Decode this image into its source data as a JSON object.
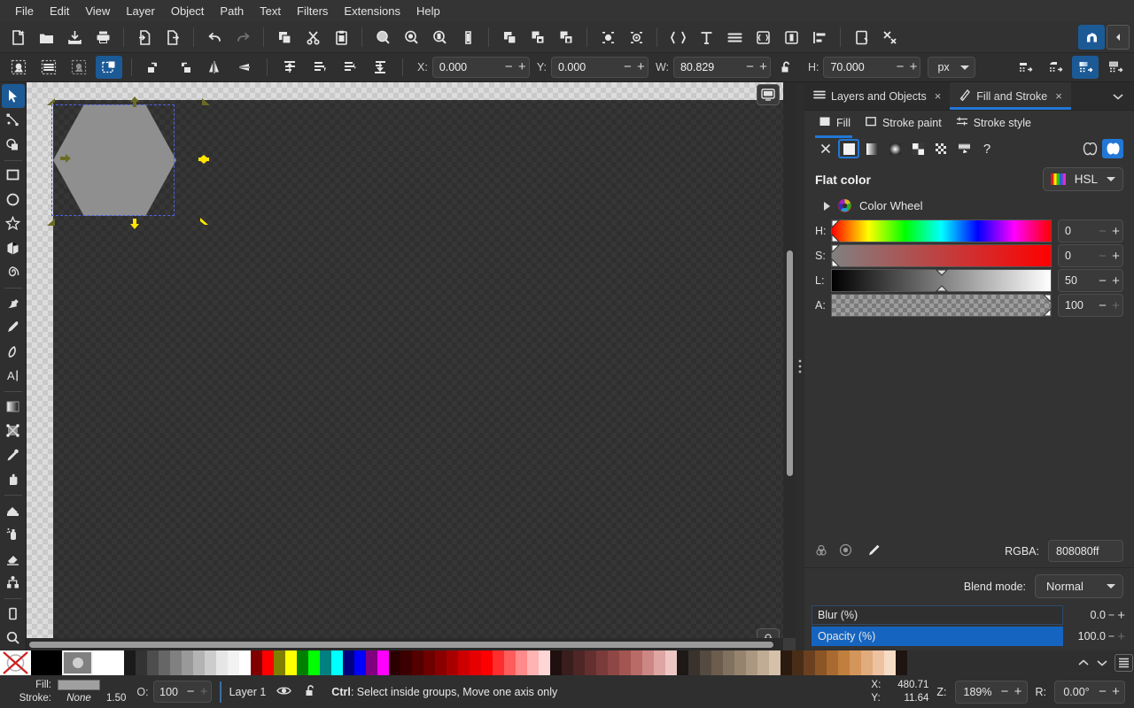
{
  "app": {
    "title": "Inkscape",
    "theme_bg": "#2d2d2d",
    "accent": "#2277d6"
  },
  "menubar": {
    "items": [
      {
        "label": "File"
      },
      {
        "label": "Edit"
      },
      {
        "label": "View"
      },
      {
        "label": "Layer"
      },
      {
        "label": "Object"
      },
      {
        "label": "Path"
      },
      {
        "label": "Text"
      },
      {
        "label": "Filters"
      },
      {
        "label": "Extensions"
      },
      {
        "label": "Help"
      }
    ]
  },
  "commandbar": {
    "buttons": [
      {
        "name": "new-document",
        "icon": "new-document-icon"
      },
      {
        "name": "open-document",
        "icon": "open-folder-icon"
      },
      {
        "name": "save-document",
        "icon": "save-icon"
      },
      {
        "name": "print-document",
        "icon": "print-icon"
      },
      {
        "name": "import",
        "icon": "import-icon"
      },
      {
        "name": "export",
        "icon": "export-icon"
      },
      {
        "name": "undo",
        "icon": "undo-arrow-icon"
      },
      {
        "name": "redo",
        "icon": "redo-arrow-icon"
      },
      {
        "name": "copy",
        "icon": "copy-icon"
      },
      {
        "name": "cut",
        "icon": "scissors-icon"
      },
      {
        "name": "paste",
        "icon": "clipboard-icon"
      },
      {
        "name": "zoom-selection",
        "icon": "zoom-selection-icon"
      },
      {
        "name": "zoom-drawing",
        "icon": "zoom-drawing-icon"
      },
      {
        "name": "zoom-page",
        "icon": "zoom-page-icon"
      },
      {
        "name": "zoom-page-width",
        "icon": "zoom-width-icon"
      },
      {
        "name": "zoom-center-page",
        "icon": "zoom-center-icon"
      },
      {
        "name": "duplicate",
        "icon": "duplicate-icon"
      },
      {
        "name": "group",
        "icon": "group-icon"
      },
      {
        "name": "ungroup",
        "icon": "ungroup-icon"
      },
      {
        "name": "clip-set",
        "icon": "clip-icon"
      },
      {
        "name": "mask-set",
        "icon": "mask-icon"
      },
      {
        "name": "xml-editor",
        "icon": "xml-editor-icon"
      },
      {
        "name": "text-tool-dialog",
        "icon": "text-icon"
      },
      {
        "name": "layers-dialog",
        "icon": "layers-icon"
      },
      {
        "name": "document-properties",
        "icon": "document-properties-icon"
      },
      {
        "name": "document-resources",
        "icon": "document-resources-icon"
      },
      {
        "name": "align-distribute",
        "icon": "align-icon"
      },
      {
        "name": "preferences",
        "icon": "preferences-icon"
      },
      {
        "name": "input-devices",
        "icon": "tools-icon"
      }
    ],
    "snap_toggle": {
      "name": "snap-controls-toggle",
      "icon": "snap-magnet-icon",
      "active": true
    },
    "collapse": {
      "name": "collapse-toolbar-button",
      "icon": "chevron-left-icon"
    }
  },
  "toolcontrols": {
    "buttons": [
      {
        "name": "select-all",
        "icon": "select-all-icon",
        "active": false
      },
      {
        "name": "select-all-in-all-layers",
        "icon": "select-all-layers-icon",
        "active": false
      },
      {
        "name": "deselect",
        "icon": "deselect-icon",
        "active": false
      },
      {
        "name": "select-touch",
        "icon": "rubber-band-touch-icon",
        "active": true
      },
      {
        "name": "rotate-ccw",
        "icon": "rotate-ccw-icon",
        "active": false
      },
      {
        "name": "rotate-cw",
        "icon": "rotate-cw-icon",
        "active": false
      },
      {
        "name": "flip-horizontal",
        "icon": "flip-horizontal-icon",
        "active": false
      },
      {
        "name": "flip-vertical",
        "icon": "flip-vertical-icon",
        "active": false
      },
      {
        "name": "raise-to-top",
        "icon": "raise-to-top-icon",
        "active": false
      },
      {
        "name": "raise",
        "icon": "raise-icon",
        "active": false
      },
      {
        "name": "lower",
        "icon": "lower-icon",
        "active": false
      },
      {
        "name": "lower-to-bottom",
        "icon": "lower-to-bottom-icon",
        "active": false
      }
    ],
    "x": {
      "label": "X:",
      "value": "0.000"
    },
    "y": {
      "label": "Y:",
      "value": "0.000"
    },
    "w": {
      "label": "W:",
      "value": "80.829"
    },
    "h": {
      "label": "H:",
      "value": "70.000"
    },
    "lock": {
      "name": "lock-wh-ratio",
      "icon": "lock-open-icon"
    },
    "units": {
      "value": "px"
    },
    "snap_buttons": [
      {
        "name": "affect-stroke-width",
        "icon": "scale-stroke-icon",
        "active": false
      },
      {
        "name": "affect-rounded-corners",
        "icon": "scale-corners-icon",
        "active": false
      },
      {
        "name": "affect-gradients",
        "icon": "transform-gradient-icon",
        "active": true
      },
      {
        "name": "affect-patterns",
        "icon": "transform-pattern-icon",
        "active": false
      }
    ]
  },
  "toolbox": {
    "tools": [
      {
        "name": "selector-tool",
        "icon": "arrow-cursor-icon",
        "active": true
      },
      {
        "name": "node-tool",
        "icon": "node-editor-icon",
        "active": false
      },
      {
        "name": "shape-builder-tool",
        "icon": "shape-builder-icon",
        "active": false
      },
      {
        "name": "rectangle-tool",
        "icon": "rectangle-icon",
        "active": false
      },
      {
        "name": "ellipse-tool",
        "icon": "ellipse-icon",
        "active": false
      },
      {
        "name": "star-tool",
        "icon": "star-icon",
        "active": false
      },
      {
        "name": "box3d-tool",
        "icon": "cube-3d-icon",
        "active": false
      },
      {
        "name": "spiral-tool",
        "icon": "spiral-icon",
        "active": false
      },
      {
        "name": "pencil-tool",
        "icon": "pencil-freehand-icon",
        "active": false
      },
      {
        "name": "pen-tool",
        "icon": "bezier-pen-icon",
        "active": false
      },
      {
        "name": "calligraphy-tool",
        "icon": "calligraphy-icon",
        "active": false
      },
      {
        "name": "text-tool",
        "icon": "text-a-icon",
        "active": false
      },
      {
        "name": "gradient-tool",
        "icon": "gradient-icon",
        "active": false
      },
      {
        "name": "mesh-gradient-tool",
        "icon": "mesh-gradient-icon",
        "active": false
      },
      {
        "name": "dropper-tool",
        "icon": "eyedropper-icon",
        "active": false
      },
      {
        "name": "tweak-tool",
        "icon": "tweak-hand-icon",
        "active": false
      },
      {
        "name": "paint-bucket-tool",
        "icon": "paint-bucket-icon",
        "active": false
      },
      {
        "name": "spray-tool",
        "icon": "spray-can-icon",
        "active": false
      },
      {
        "name": "eraser-tool",
        "icon": "eraser-icon",
        "active": false
      },
      {
        "name": "connector-tool",
        "icon": "connector-icon",
        "active": false
      },
      {
        "name": "pages-tool",
        "icon": "page-icon",
        "active": false
      },
      {
        "name": "zoom-tool",
        "icon": "magnifier-icon",
        "active": false
      }
    ]
  },
  "canvas": {
    "object": {
      "name": "hexagon-shape",
      "fill": "#8f8f8f",
      "description": "hexagon"
    },
    "selection": {
      "dashed_color": "#4f62e0",
      "handle_color": "#ffe400",
      "handle_color_dim": "#6b6b25"
    },
    "display_mode_button": {
      "name": "display-mode-button",
      "icon": "monitor-icon"
    },
    "cms_button": {
      "name": "color-management-button",
      "icon": "cms-icon"
    },
    "dock_grip": {
      "name": "dock-resize-grip",
      "icon": "grip-dots-icon"
    }
  },
  "dock": {
    "tabs": [
      {
        "name": "layers-and-objects",
        "label": "Layers and Objects",
        "icon": "layers-stack-icon",
        "active": false,
        "close": "×"
      },
      {
        "name": "fill-and-stroke",
        "label": "Fill and Stroke",
        "icon": "fill-stroke-icon",
        "active": true,
        "close": "×"
      }
    ],
    "tab_menu": {
      "name": "dock-menu-button",
      "icon": "chevron-down-icon"
    },
    "fillstroke": {
      "subtabs": [
        {
          "name": "tab-fill",
          "label": "Fill",
          "icon": "fill-square-icon",
          "active": true
        },
        {
          "name": "tab-stroke-paint",
          "label": "Stroke paint",
          "icon": "stroke-square-icon",
          "active": false
        },
        {
          "name": "tab-stroke-style",
          "label": "Stroke style",
          "icon": "stroke-style-icon",
          "active": false
        }
      ],
      "paint_types": [
        {
          "name": "paint-none",
          "icon": "x-none-icon",
          "selected": false
        },
        {
          "name": "paint-flat-color",
          "icon": "flat-color-icon",
          "selected": true
        },
        {
          "name": "paint-linear-gradient",
          "icon": "linear-gradient-icon",
          "selected": false
        },
        {
          "name": "paint-radial-gradient",
          "icon": "radial-gradient-icon",
          "selected": false
        },
        {
          "name": "paint-pattern",
          "icon": "pattern-icon",
          "selected": false
        },
        {
          "name": "paint-swatch",
          "icon": "swatch-icon",
          "selected": false
        },
        {
          "name": "paint-mesh-gradient",
          "icon": "mesh-icon",
          "selected": false
        },
        {
          "name": "paint-unknown",
          "icon": "question-mark-icon",
          "selected": false
        }
      ],
      "fillrule_buttons": [
        {
          "name": "fill-rule-evenodd",
          "icon": "fill-rule-evenodd-icon",
          "selected": false
        },
        {
          "name": "fill-rule-nonzero",
          "icon": "fill-rule-nonzero-icon",
          "selected": true
        }
      ],
      "flat_color_label": "Flat color",
      "color_mode": {
        "label": "HSL",
        "name": "color-mode-selector"
      },
      "color_wheel": {
        "label": "Color Wheel",
        "expanded": false
      },
      "sliders": [
        {
          "name": "hue-slider",
          "label": "H:",
          "value": "0",
          "minus_disabled": true,
          "plus_disabled": false
        },
        {
          "name": "saturation-slider",
          "label": "S:",
          "value": "0",
          "minus_disabled": true,
          "plus_disabled": false
        },
        {
          "name": "lightness-slider",
          "label": "L:",
          "value": "50",
          "minus_disabled": false,
          "plus_disabled": false
        },
        {
          "name": "alpha-slider",
          "label": "A:",
          "value": "100",
          "minus_disabled": false,
          "plus_disabled": true
        }
      ],
      "rgba": {
        "label": "RGBA:",
        "value": "808080ff"
      },
      "bottom_icons": [
        {
          "name": "color-managed-icon",
          "icon": "cms-circle-icon"
        },
        {
          "name": "out-of-gamut-icon",
          "icon": "gamut-warning-icon"
        },
        {
          "name": "pick-color-button",
          "icon": "eyedropper-icon"
        }
      ],
      "blend_mode": {
        "label": "Blend mode:",
        "value": "Normal"
      },
      "blur": {
        "label": "Blur (%)",
        "value": "0.0"
      },
      "opacity": {
        "label": "Opacity (%)",
        "value": "100.0"
      }
    }
  },
  "palette": {
    "colors": [
      "none",
      "#000000",
      "#808080",
      "#ffffff",
      "#1a1a1a",
      "#333333",
      "#4d4d4d",
      "#666666",
      "#808080",
      "#999999",
      "#b3b3b3",
      "#cccccc",
      "#e6e6e6",
      "#f2f2f2",
      "#ffffff",
      "#800000",
      "#ff0000",
      "#808000",
      "#ffff00",
      "#008000",
      "#00ff00",
      "#008080",
      "#00ffff",
      "#000080",
      "#0000ff",
      "#800080",
      "#ff00ff",
      "#2b0000",
      "#3d0000",
      "#550000",
      "#6e0000",
      "#8a0000",
      "#a80000",
      "#cc0000",
      "#e60000",
      "#ff0000",
      "#ff2e2e",
      "#ff5c5c",
      "#ff8a8a",
      "#ffb3b3",
      "#ffd6d6",
      "#1f0f0f",
      "#3a1d1d",
      "#4f2626",
      "#63302f",
      "#7a3b3a",
      "#8e4745",
      "#a35552",
      "#b96b68",
      "#cc8683",
      "#dda6a3",
      "#eec7c5",
      "#1c1917",
      "#3a332d",
      "#554a40",
      "#6b5c4e",
      "#80705e",
      "#96836e",
      "#ab9780",
      "#c0ab94",
      "#d5c0aa",
      "#2b1b0f",
      "#4a2d16",
      "#6b4020",
      "#8c5526",
      "#a86a30",
      "#c07f3d",
      "#d4955a",
      "#e0ab7d",
      "#ecc2a1",
      "#f6dcc4",
      "#1e1510"
    ],
    "controls": {
      "scroll_up": {
        "name": "palette-scroll-up",
        "icon": "chevron-up-icon"
      },
      "scroll_down": {
        "name": "palette-scroll-down",
        "icon": "chevron-down-icon"
      },
      "menu": {
        "name": "palette-menu-button",
        "icon": "hamburger-menu-icon"
      }
    }
  },
  "statusbar": {
    "fill": {
      "label": "Fill:",
      "swatch": "#a0a0a0"
    },
    "stroke": {
      "label": "Stroke:",
      "value": "None",
      "width": "1.50"
    },
    "opacity": {
      "label": "O:",
      "value": "100"
    },
    "layer": {
      "name": "layer-indicator",
      "label": "Layer 1",
      "visibility_icon": "eye-icon",
      "lock_icon": "lock-open-icon"
    },
    "message": {
      "key": "Ctrl",
      "text": ": Select inside groups, Move one axis only"
    },
    "cursor": {
      "x_label": "X:",
      "x_value": "480.71",
      "y_label": "Y:",
      "y_value": "11.64"
    },
    "zoom": {
      "label": "Z:",
      "value": "189%"
    },
    "rotation": {
      "label": "R:",
      "value": "0.00°"
    }
  }
}
